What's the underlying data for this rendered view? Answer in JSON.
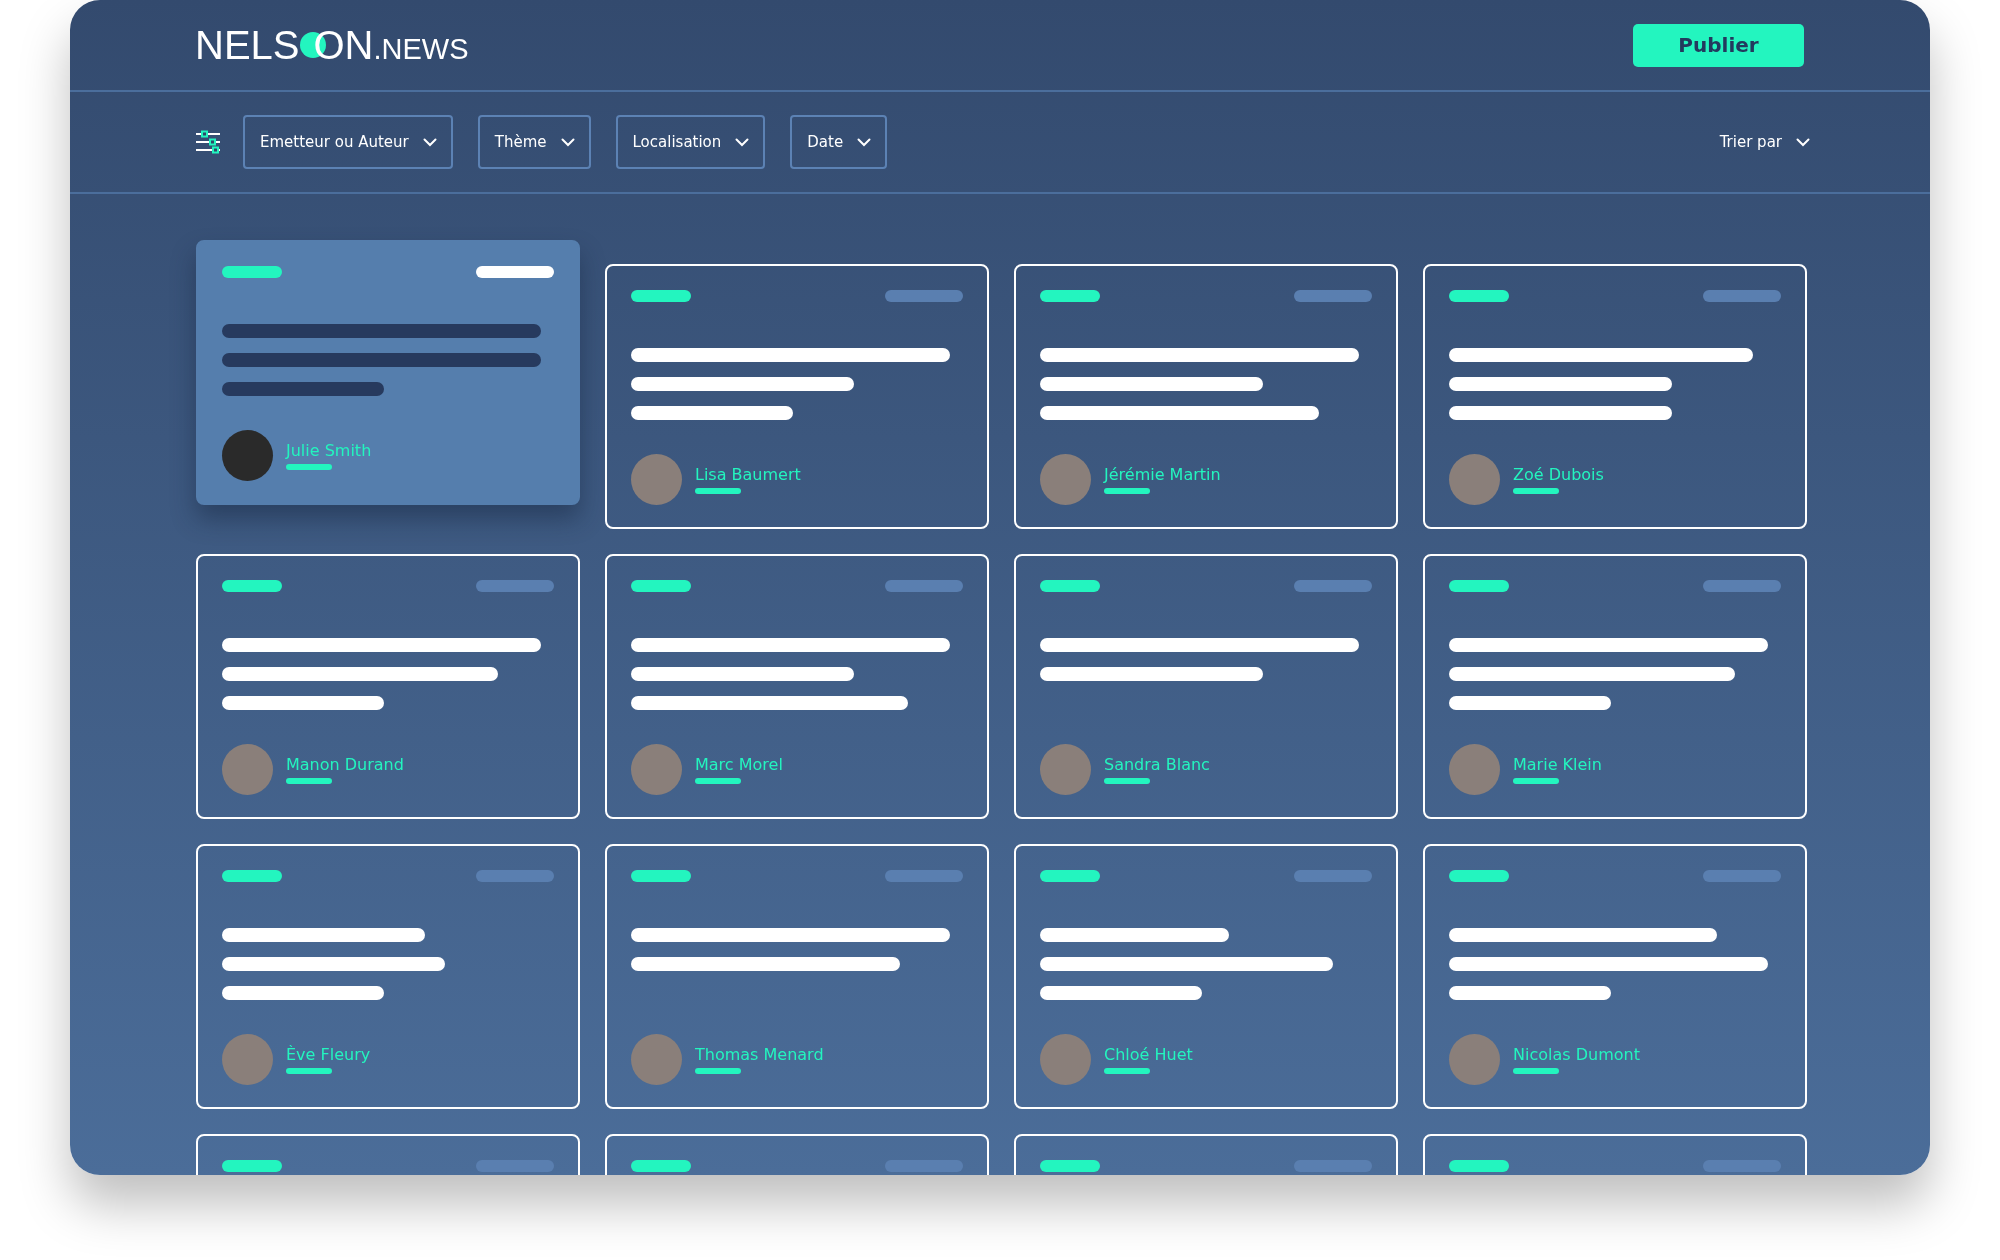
{
  "header": {
    "logo": {
      "start": "NELS",
      "end": "ON",
      "suffix": ".NEWS"
    },
    "publish_button": "Publier"
  },
  "filters": {
    "items": [
      {
        "label": "Emetteur ou Auteur"
      },
      {
        "label": "Thème"
      },
      {
        "label": "Localisation"
      },
      {
        "label": "Date"
      }
    ],
    "sort": "Trier par"
  },
  "cards": [
    {
      "author": "Julie Smith",
      "selected": true
    },
    {
      "author": "Lisa Baumert",
      "selected": false
    },
    {
      "author": "Jérémie Martin",
      "selected": false
    },
    {
      "author": "Zoé Dubois",
      "selected": false
    },
    {
      "author": "Manon Durand",
      "selected": false
    },
    {
      "author": "Marc Morel",
      "selected": false
    },
    {
      "author": "Sandra Blanc",
      "selected": false
    },
    {
      "author": "Marie Klein",
      "selected": false
    },
    {
      "author": "Ève Fleury",
      "selected": false
    },
    {
      "author": "Thomas Menard",
      "selected": false
    },
    {
      "author": "Chloé Huet",
      "selected": false
    },
    {
      "author": "Nicolas Dumont",
      "selected": false
    },
    {
      "selected": false
    },
    {
      "selected": false
    },
    {
      "selected": false
    },
    {
      "selected": false
    }
  ]
}
